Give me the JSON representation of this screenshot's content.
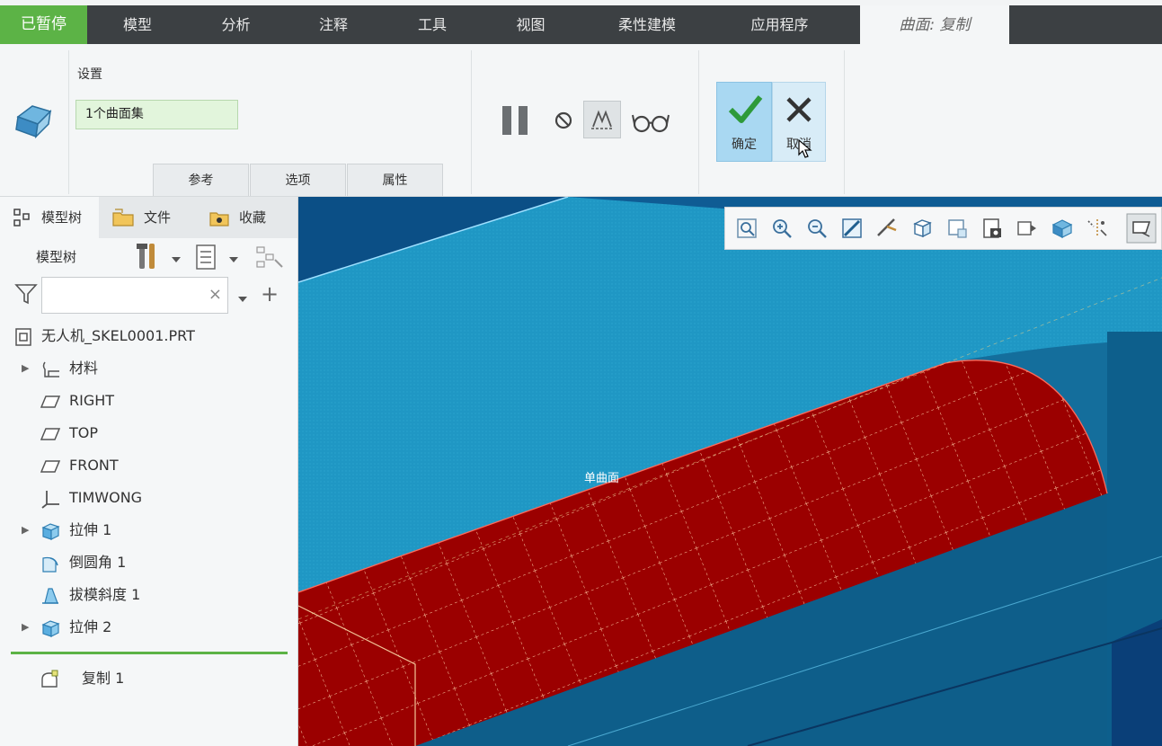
{
  "status_badge": "已暂停",
  "tabs": [
    "模型",
    "分析",
    "注释",
    "工具",
    "视图",
    "柔性建模",
    "应用程序"
  ],
  "active_tab": "曲面: 复制",
  "ribbon": {
    "settings_label": "设置",
    "surface_set_value": "1个曲面集",
    "subtabs": [
      "参考",
      "选项",
      "属性"
    ],
    "ok_label": "确定",
    "cancel_label": "取消"
  },
  "panel_tabs": [
    "模型树",
    "文件",
    "收藏"
  ],
  "model_tree": {
    "title": "模型树",
    "filter_placeholder": "",
    "clear_symbol": "×",
    "add_symbol": "+",
    "items": [
      {
        "label": "无人机_SKEL0001.PRT",
        "icon": "part-icon",
        "expandable": false
      },
      {
        "label": "材料",
        "icon": "material-icon",
        "expandable": true
      },
      {
        "label": "RIGHT",
        "icon": "datum-plane-icon",
        "expandable": false
      },
      {
        "label": "TOP",
        "icon": "datum-plane-icon",
        "expandable": false
      },
      {
        "label": "FRONT",
        "icon": "datum-plane-icon",
        "expandable": false
      },
      {
        "label": "TIMWONG",
        "icon": "coordinate-system-icon",
        "expandable": false
      },
      {
        "label": "拉伸 1",
        "icon": "extrude-icon",
        "expandable": true
      },
      {
        "label": "倒圆角 1",
        "icon": "round-icon",
        "expandable": false
      },
      {
        "label": "拔模斜度 1",
        "icon": "draft-icon",
        "expandable": false
      },
      {
        "label": "拉伸 2",
        "icon": "extrude-icon",
        "expandable": true
      },
      {
        "label": "复制 1",
        "icon": "copy-surface-icon",
        "expandable": false
      }
    ]
  },
  "viewport": {
    "surface_tag": "单曲面"
  },
  "colors": {
    "status_green": "#5cb346",
    "tab_bar": "#3c4043",
    "selection_red": "#9b0000",
    "model_blue": "#1c8dba"
  }
}
